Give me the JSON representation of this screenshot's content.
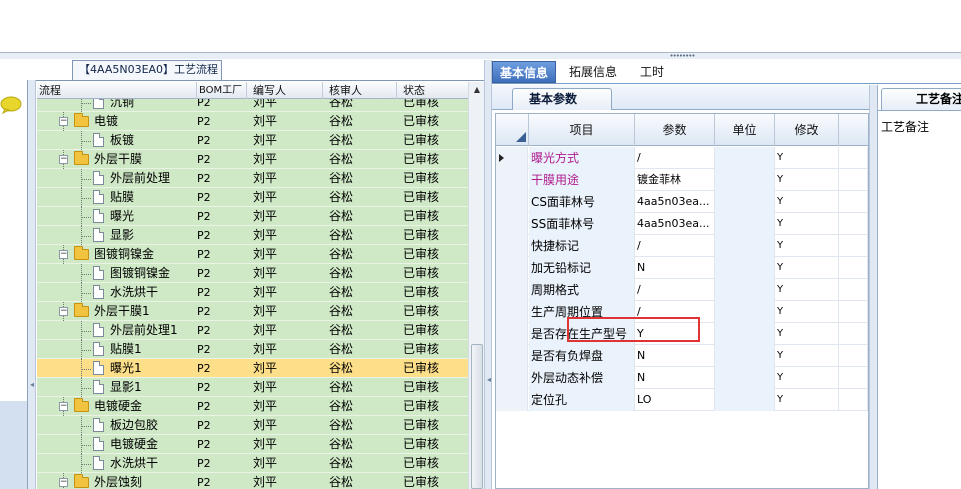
{
  "flow_panel": {
    "tab_label": "【4AA5N03EA0】工艺流程",
    "columns": [
      "流程",
      "BOM工厂",
      "编写人",
      "核审人",
      "状态"
    ],
    "rows": [
      {
        "name": "沉铜",
        "type": "doc",
        "bom": "P2",
        "writer": "刘平",
        "reviewer": "谷松",
        "status": "已审核"
      },
      {
        "name": "电镀",
        "type": "folder",
        "bom": "P2",
        "writer": "刘平",
        "reviewer": "谷松",
        "status": "已审核"
      },
      {
        "name": "板镀",
        "type": "doc",
        "bom": "P2",
        "writer": "刘平",
        "reviewer": "谷松",
        "status": "已审核"
      },
      {
        "name": "外层干膜",
        "type": "folder",
        "bom": "P2",
        "writer": "刘平",
        "reviewer": "谷松",
        "status": "已审核"
      },
      {
        "name": "外层前处理",
        "type": "doc",
        "bom": "P2",
        "writer": "刘平",
        "reviewer": "谷松",
        "status": "已审核"
      },
      {
        "name": "贴膜",
        "type": "doc",
        "bom": "P2",
        "writer": "刘平",
        "reviewer": "谷松",
        "status": "已审核"
      },
      {
        "name": "曝光",
        "type": "doc",
        "bom": "P2",
        "writer": "刘平",
        "reviewer": "谷松",
        "status": "已审核"
      },
      {
        "name": "显影",
        "type": "doc",
        "bom": "P2",
        "writer": "刘平",
        "reviewer": "谷松",
        "status": "已审核"
      },
      {
        "name": "图镀铜镍金",
        "type": "folder",
        "bom": "P2",
        "writer": "刘平",
        "reviewer": "谷松",
        "status": "已审核"
      },
      {
        "name": "图镀铜镍金",
        "type": "doc",
        "bom": "P2",
        "writer": "刘平",
        "reviewer": "谷松",
        "status": "已审核"
      },
      {
        "name": "水洗烘干",
        "type": "doc",
        "bom": "P2",
        "writer": "刘平",
        "reviewer": "谷松",
        "status": "已审核"
      },
      {
        "name": "外层干膜1",
        "type": "folder",
        "bom": "P2",
        "writer": "刘平",
        "reviewer": "谷松",
        "status": "已审核"
      },
      {
        "name": "外层前处理1",
        "type": "doc",
        "bom": "P2",
        "writer": "刘平",
        "reviewer": "谷松",
        "status": "已审核"
      },
      {
        "name": "贴膜1",
        "type": "doc",
        "bom": "P2",
        "writer": "刘平",
        "reviewer": "谷松",
        "status": "已审核"
      },
      {
        "name": "曝光1",
        "type": "doc",
        "bom": "P2",
        "writer": "刘平",
        "reviewer": "谷松",
        "status": "已审核",
        "selected": true
      },
      {
        "name": "显影1",
        "type": "doc",
        "bom": "P2",
        "writer": "刘平",
        "reviewer": "谷松",
        "status": "已审核"
      },
      {
        "name": "电镀硬金",
        "type": "folder",
        "bom": "P2",
        "writer": "刘平",
        "reviewer": "谷松",
        "status": "已审核"
      },
      {
        "name": "板边包胶",
        "type": "doc",
        "bom": "P2",
        "writer": "刘平",
        "reviewer": "谷松",
        "status": "已审核"
      },
      {
        "name": "电镀硬金",
        "type": "doc",
        "bom": "P2",
        "writer": "刘平",
        "reviewer": "谷松",
        "status": "已审核"
      },
      {
        "name": "水洗烘干",
        "type": "doc",
        "bom": "P2",
        "writer": "刘平",
        "reviewer": "谷松",
        "status": "已审核"
      },
      {
        "name": "外层蚀刻",
        "type": "folder",
        "bom": "P2",
        "writer": "刘平",
        "reviewer": "谷松",
        "status": "已审核"
      }
    ]
  },
  "tabs": [
    {
      "label": "基本信息",
      "active": true
    },
    {
      "label": "拓展信息",
      "active": false
    },
    {
      "label": "工时",
      "active": false
    }
  ],
  "subtab_label": "基本参数",
  "param_grid": {
    "columns": [
      "项目",
      "参数",
      "单位",
      "修改"
    ],
    "rows": [
      {
        "item": "曝光方式",
        "param": "/",
        "unit": "",
        "mod": "Y",
        "magenta": true,
        "current": true
      },
      {
        "item": "干膜用途",
        "param": "镀金菲林",
        "unit": "",
        "mod": "Y",
        "magenta": true
      },
      {
        "item": "CS面菲林号",
        "param": "4aa5n03ea...",
        "unit": "",
        "mod": "Y"
      },
      {
        "item": "SS面菲林号",
        "param": "4aa5n03ea...",
        "unit": "",
        "mod": "Y"
      },
      {
        "item": "快捷标记",
        "param": "/",
        "unit": "",
        "mod": "Y"
      },
      {
        "item": "加无铅标记",
        "param": "N",
        "unit": "",
        "mod": "Y"
      },
      {
        "item": "周期格式",
        "param": "/",
        "unit": "",
        "mod": "Y"
      },
      {
        "item": "生产周期位置",
        "param": "/",
        "unit": "",
        "mod": "Y"
      },
      {
        "item": "是否存在生产型号",
        "param": "Y",
        "unit": "",
        "mod": "Y"
      },
      {
        "item": "是否有负焊盘",
        "param": "N",
        "unit": "",
        "mod": "Y"
      },
      {
        "item": "外层动态补偿",
        "param": "N",
        "unit": "",
        "mod": "Y"
      },
      {
        "item": "定位孔",
        "param": "LO",
        "unit": "",
        "mod": "Y"
      }
    ]
  },
  "remark_panel": {
    "tab_label": "工艺备注",
    "label": "工艺备注"
  },
  "colors": {
    "tree_bg": "#cfe8c6",
    "selected_row": "#fddf8a",
    "active_tab": "#3e6fb9",
    "magenta_text": "#b01c8e",
    "highlight_box": "#e03434"
  }
}
